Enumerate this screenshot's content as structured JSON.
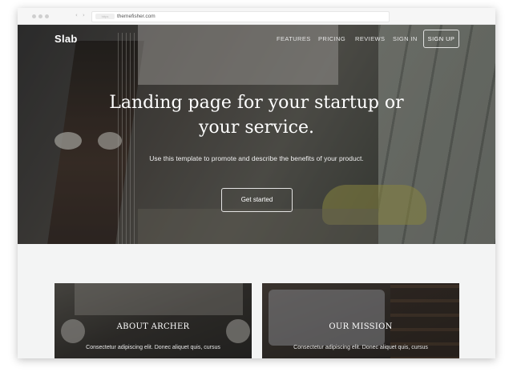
{
  "browser": {
    "url_badge": "https",
    "url": "themefisher.com",
    "nav_arrows": "‹ ›"
  },
  "site": {
    "logo": "Slab",
    "nav": {
      "features": "FEATURES",
      "pricing": "PRICING",
      "reviews": "REVIEWS",
      "sign_in": "SIGN IN",
      "sign_up": "SIGN UP"
    }
  },
  "hero": {
    "headline_line1": "Landing page for your startup or",
    "headline_line2": "your service.",
    "subtitle": "Use this template to promote and describe the benefits of your product.",
    "cta": "Get started"
  },
  "cards": [
    {
      "title": "ABOUT ARCHER",
      "text": "Consectetur adipiscing elit. Donec aliquet quis, cursus"
    },
    {
      "title": "OUR MISSION",
      "text": "Consectetur adipiscing elit. Donec aliquet quis, cursus"
    }
  ],
  "colors": {
    "hero_overlay": "#1f1f1f",
    "section_bg": "#f3f4f4",
    "text_on_dark": "#ffffff"
  }
}
